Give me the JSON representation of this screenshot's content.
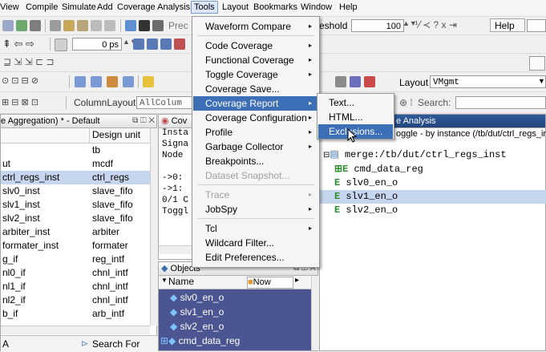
{
  "menubar": [
    "View",
    "Compile",
    "Simulate",
    "Add",
    "Coverage Analysis",
    "Tools",
    "Layout",
    "Bookmarks",
    "Window",
    "Help"
  ],
  "toolbar": {
    "prec_label": "Prec",
    "threshold_label": "eshold",
    "threshold_value": "100",
    "help_label": "Help",
    "time_value": "0 ps",
    "layout_label": "Layout",
    "layout_value": "VMgmt",
    "column_layout_label": "ColumnLayout",
    "column_layout_value": "AllColum",
    "search_label": "Search:"
  },
  "structure_pane": {
    "title": "e Aggregation) * - Default",
    "col_unit": "Design unit",
    "rows": [
      {
        "name": "",
        "unit": "tb"
      },
      {
        "name": "ut",
        "unit": "mcdf"
      },
      {
        "name": "ctrl_regs_inst",
        "unit": "ctrl_regs"
      },
      {
        "name": "slv0_inst",
        "unit": "slave_fifo"
      },
      {
        "name": "slv1_inst",
        "unit": "slave_fifo"
      },
      {
        "name": "slv2_inst",
        "unit": "slave_fifo"
      },
      {
        "name": "arbiter_inst",
        "unit": "arbiter"
      },
      {
        "name": "formater_inst",
        "unit": "formater"
      },
      {
        "name": "g_if",
        "unit": "reg_intf"
      },
      {
        "name": "nl0_if",
        "unit": "chnl_intf"
      },
      {
        "name": "nl1_if",
        "unit": "chnl_intf"
      },
      {
        "name": "nl2_if",
        "unit": "chnl_intf"
      },
      {
        "name": "b_if",
        "unit": "arb_intf"
      }
    ],
    "search_prefix": "A",
    "search_label": "Search For"
  },
  "cov_pane": {
    "title": "Cov",
    "lines": [
      "Insta",
      "Signa",
      "Node",
      "",
      "->0:",
      "->1:",
      "0/1 C",
      "Toggl"
    ]
  },
  "objects_pane": {
    "title": "Objects",
    "col_name": "Name",
    "now_label": "Now",
    "items": [
      "slv0_en_o",
      "slv1_en_o",
      "slv2_en_o",
      "cmd_data_reg"
    ]
  },
  "analysis_pane": {
    "title": "e Analysis",
    "subtitle": "oggle - by instance (/tb/dut/ctrl_regs_inst)",
    "root": "merge:/tb/dut/ctrl_regs_inst",
    "items": [
      "cmd_data_reg",
      "slv0_en_o",
      "slv1_en_o",
      "slv2_en_o"
    ]
  },
  "tools_menu": [
    {
      "label": "Waveform Compare",
      "sub": true
    },
    {
      "sep": true
    },
    {
      "label": "Code Coverage",
      "sub": true
    },
    {
      "label": "Functional Coverage",
      "sub": true
    },
    {
      "label": "Toggle Coverage",
      "sub": true
    },
    {
      "label": "Coverage Save..."
    },
    {
      "label": "Coverage Report",
      "sub": true,
      "hl": true
    },
    {
      "label": "Coverage Configuration",
      "sub": true
    },
    {
      "label": "Profile",
      "sub": true
    },
    {
      "label": "Garbage Collector",
      "sub": true
    },
    {
      "label": "Breakpoints..."
    },
    {
      "label": "Dataset Snapshot...",
      "dis": true
    },
    {
      "sep": true
    },
    {
      "label": "Trace",
      "sub": true,
      "dis": true
    },
    {
      "label": "JobSpy",
      "sub": true
    },
    {
      "sep": true
    },
    {
      "label": "Tcl",
      "sub": true
    },
    {
      "label": "Wildcard Filter..."
    },
    {
      "label": "Edit Preferences..."
    }
  ],
  "coverage_report_submenu": [
    "Text...",
    "HTML...",
    "Exclusions..."
  ],
  "colors": {
    "accent": "#3d6fb6",
    "selection": "#c6d6ee",
    "objects_bg": "#4a5591",
    "hdl_green": "#2e8b2e"
  }
}
